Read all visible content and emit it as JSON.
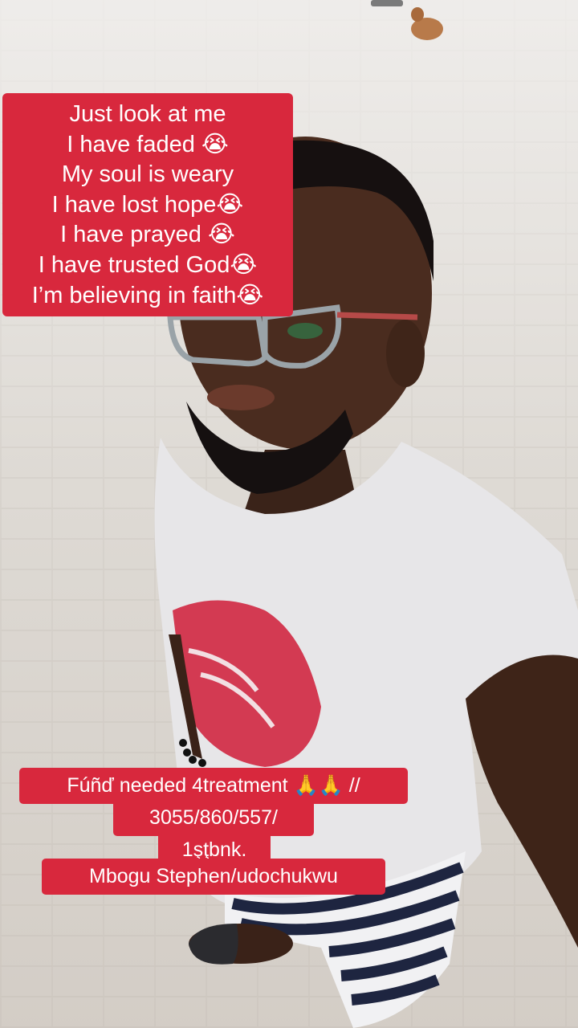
{
  "caption_top": {
    "lines": [
      "Just look at me",
      "I have faded 😭",
      "My soul is weary",
      "I have lost hope😭",
      "I have prayed 😭",
      "I have trusted God😭",
      "I’m believing in faith😭"
    ]
  },
  "caption_bottom": {
    "lines": [
      "Fúñď needed 4treatment 🙏🙏 //",
      "3055/860/557/",
      "1şţbnk.",
      "Mbogu Stephen/udochukwu"
    ]
  },
  "colors": {
    "caption_bg": "#d8283d",
    "caption_text": "#ffffff",
    "pavement": "#e2ded9"
  }
}
